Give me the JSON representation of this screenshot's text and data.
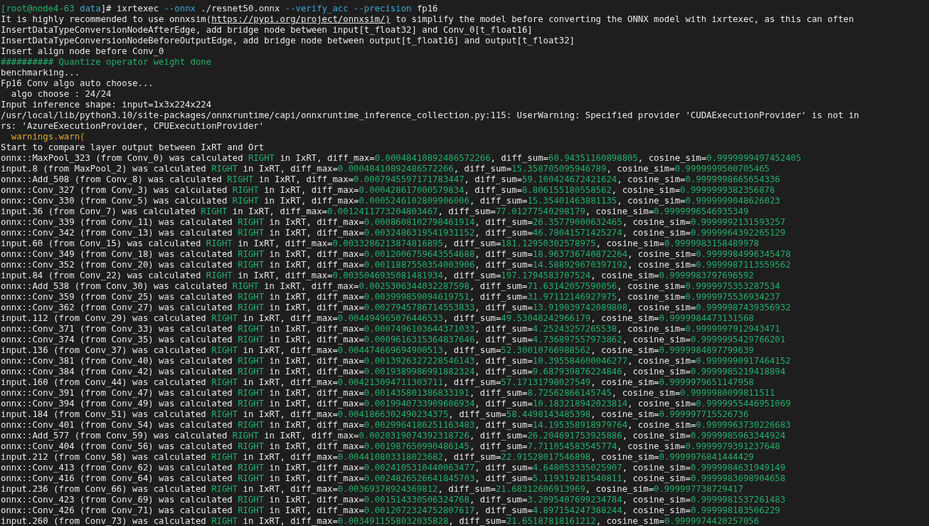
{
  "terminal": {
    "lines": [
      {
        "segments": [
          {
            "text": "[root@node4-63",
            "kind": "host"
          },
          {
            "text": " data",
            "kind": "path"
          },
          {
            "text": "]# ixrtexec ",
            "kind": "plain"
          },
          {
            "text": "--onnx",
            "kind": "flag"
          },
          {
            "text": " ./resnet50.onnx ",
            "kind": "plain"
          },
          {
            "text": "--verify_acc --precision",
            "kind": "flag"
          },
          {
            "text": " fp16",
            "kind": "plain"
          }
        ]
      },
      {
        "segments": [
          {
            "text": "It is highly recommended to use onnxsim(",
            "kind": "plain"
          },
          {
            "text": "https://pypi.org/project/onnxsim/)",
            "kind": "link"
          },
          {
            "text": " to simplify the model before converting the ONNX model with ixrtexec, as this can often",
            "kind": "plain"
          }
        ]
      },
      {
        "segments": [
          {
            "text": "InsertDataTypeConversionNodeAfterEdge, add bridge node between input[t_float32] and Conv_0[t_float16]",
            "kind": "plain"
          }
        ]
      },
      {
        "segments": [
          {
            "text": "InsertDataTypeConversionNodeBeforeOutputEdge, add bridge node between output[t_float16] and output[t_float32]",
            "kind": "plain"
          }
        ]
      },
      {
        "segments": [
          {
            "text": "Insert align node before Conv_0",
            "kind": "plain"
          }
        ]
      },
      {
        "segments": [
          {
            "text": "########## Quantize operator weight done",
            "kind": "ok"
          }
        ]
      },
      {
        "segments": [
          {
            "text": "benchmarking...",
            "kind": "plain"
          }
        ]
      },
      {
        "segments": [
          {
            "text": "Fp16 Conv algo auto choose...",
            "kind": "plain"
          }
        ]
      },
      {
        "segments": [
          {
            "text": "  algo choose : 24/24",
            "kind": "plain"
          }
        ]
      },
      {
        "segments": [
          {
            "text": "Input inference shape: input=1x3x224x224",
            "kind": "plain"
          }
        ]
      },
      {
        "segments": [
          {
            "text": "/usr/local/lib/python3.10/site-packages/onnxruntime/capi/onnxruntime_inference_collection.py:115: UserWarning: Specified provider 'CUDAExecutionProvider' is not in",
            "kind": "plain"
          }
        ]
      },
      {
        "segments": [
          {
            "text": "rs: 'AzureExecutionProvider, CPUExecutionProvider'",
            "kind": "plain"
          }
        ]
      },
      {
        "segments": [
          {
            "text": "  warnings.warn(",
            "kind": "warn"
          }
        ]
      },
      {
        "segments": [
          {
            "text": "Start to compare layer output between IxRT and Ort",
            "kind": "plain"
          }
        ]
      }
    ],
    "results": [
      {
        "subject": "onnx::MaxPool_323 (from Conv_0) was calculated ",
        "verdict": "RIGHT",
        "max_label": " in IxRT, diff_max=",
        "diff_max": "0.00048410892486572266",
        "sum_label": ", diff_sum=",
        "diff_sum": "60.94351160898805",
        "cos_label": ", cosine_sim=",
        "cosine_sim": "0.9999999497452405"
      },
      {
        "subject": "input.8 (from MaxPool_2) was calculated ",
        "verdict": "RIGHT",
        "max_label": " in IxRT, diff_max=",
        "diff_max": "0.00048410892486572266",
        "sum_label": ", diff_sum=",
        "diff_sum": "15.358705095946789",
        "cos_label": ", cosine_sim=",
        "cosine_sim": "0.9999999500705465"
      },
      {
        "subject": "onnx::Add_508 (from Conv_8) was calculated ",
        "verdict": "RIGHT",
        "max_label": " in IxRT, diff_max=",
        "diff_max": "0.0007945597171783447",
        "sum_label": ", diff_sum=",
        "diff_sum": "59.100424672421624",
        "cos_label": ", cosine_sim=",
        "cosine_sim": "0.9999998665654336"
      },
      {
        "subject": "onnx::Conv_327 (from Conv_3) was calculated ",
        "verdict": "RIGHT",
        "max_label": " in IxRT, diff_max=",
        "diff_max": "0.000428617000579834",
        "sum_label": ", diff_sum=",
        "diff_sum": "8.806155180558562",
        "cos_label": ", cosine_sim=",
        "cosine_sim": "0.9999999382356878"
      },
      {
        "subject": "onnx::Conv_330 (from Conv_5) was calculated ",
        "verdict": "RIGHT",
        "max_label": " in IxRT, diff_max=",
        "diff_max": "0.0005246102809906006",
        "sum_label": ", diff_sum=",
        "diff_sum": "15.35401463881135",
        "cos_label": ", cosine_sim=",
        "cosine_sim": "0.9999999048626023"
      },
      {
        "subject": "input.36 (from Conv_7) was calculated ",
        "verdict": "RIGHT",
        "max_label": " in IxRT, diff_max=",
        "diff_max": "0.0012411773204803467",
        "sum_label": ", diff_sum=",
        "diff_sum": "77.01277540298179",
        "cos_label": ", cosine_sim=",
        "cosine_sim": "0.9999996546935349"
      },
      {
        "subject": "onnx::Conv_339 (from Conv_11) was calculated ",
        "verdict": "RIGHT",
        "max_label": " in IxRT, diff_max=",
        "diff_max": "0.0008608102798461914",
        "sum_label": ", diff_sum=",
        "diff_sum": "26.35779000632465",
        "cos_label": ", cosine_sim=",
        "cosine_sim": "0.9999992131593257"
      },
      {
        "subject": "onnx::Conv_342 (from Conv_13) was calculated ",
        "verdict": "RIGHT",
        "max_label": " in IxRT, diff_max=",
        "diff_max": "0.0032486319541931152",
        "sum_label": ", diff_sum=",
        "diff_sum": "46.78041571425274",
        "cos_label": ", cosine_sim=",
        "cosine_sim": "0.9999964392265129"
      },
      {
        "subject": "input.60 (from Conv_15) was calculated ",
        "verdict": "RIGHT",
        "max_label": " in IxRT, diff_max=",
        "diff_max": "0.0033286213874816895",
        "sum_label": ", diff_sum=",
        "diff_sum": "181.12950302578975",
        "cos_label": ", cosine_sim=",
        "cosine_sim": "0.9999983158489978"
      },
      {
        "subject": "onnx::Conv_349 (from Conv_18) was calculated ",
        "verdict": "RIGHT",
        "max_label": " in IxRT, diff_max=",
        "diff_max": "0.0012006759643554688",
        "sum_label": ", diff_sum=",
        "diff_sum": "18.963736740872264",
        "cos_label": ", cosine_sim=",
        "cosine_sim": "0.9999984996345478"
      },
      {
        "subject": "onnx::Conv_352 (from Conv_20) was calculated ",
        "verdict": "RIGHT",
        "max_label": " in IxRT, diff_max=",
        "diff_max": "0.0011887550354003906",
        "sum_label": ", diff_sum=",
        "diff_sum": "14.588929670397192",
        "cos_label": ", cosine_sim=",
        "cosine_sim": "0.9999987113559562"
      },
      {
        "subject": "input.84 (from Conv_22) was calculated ",
        "verdict": "RIGHT",
        "max_label": " in IxRT, diff_max=",
        "diff_max": "0.0035046935081481934",
        "sum_label": ", diff_sum=",
        "diff_sum": "197.1794583707524",
        "cos_label": ", cosine_sim=",
        "cosine_sim": "0.9999983797696592"
      },
      {
        "subject": "onnx::Add_538 (from Conv_30) was calculated ",
        "verdict": "RIGHT",
        "max_label": " in IxRT, diff_max=",
        "diff_max": "0.0025306344032287598",
        "sum_label": ", diff_sum=",
        "diff_sum": "71.63142057590056",
        "cos_label": ", cosine_sim=",
        "cosine_sim": "0.9999975353287534"
      },
      {
        "subject": "onnx::Conv_359 (from Conv_25) was calculated ",
        "verdict": "RIGHT",
        "max_label": " in IxRT, diff_max=",
        "diff_max": "0.003999859094619751",
        "sum_label": ", diff_sum=",
        "diff_sum": "31.97112146927975",
        "cos_label": ", cosine_sim=",
        "cosine_sim": "0.9999975536934237"
      },
      {
        "subject": "onnx::Conv_362 (from Conv_27) was calculated ",
        "verdict": "RIGHT",
        "max_label": " in IxRT, diff_max=",
        "diff_max": "0.0027945786714553833",
        "sum_label": ", diff_sum=",
        "diff_sum": "13.919039742089808",
        "cos_label": ", cosine_sim=",
        "cosine_sim": "0.9999987439356932"
      },
      {
        "subject": "input.112 (from Conv_29) was calculated ",
        "verdict": "RIGHT",
        "max_label": " in IxRT, diff_max=",
        "diff_max": "0.004494965076446533",
        "sum_label": ", diff_sum=",
        "diff_sum": "49.53048242966179",
        "cos_label": ", cosine_sim=",
        "cosine_sim": "0.9999984473131568"
      },
      {
        "subject": "onnx::Conv_371 (from Conv_33) was calculated ",
        "verdict": "RIGHT",
        "max_label": " in IxRT, diff_max=",
        "diff_max": "0.0007496103644371033",
        "sum_label": ", diff_sum=",
        "diff_sum": "4.25243257265538",
        "cos_label": ", cosine_sim=",
        "cosine_sim": "0.9999997912943471"
      },
      {
        "subject": "onnx::Conv_374 (from Conv_35) was calculated ",
        "verdict": "RIGHT",
        "max_label": " in IxRT, diff_max=",
        "diff_max": "0.0009616315364837646",
        "sum_label": ", diff_sum=",
        "diff_sum": "4.736897557973862",
        "cos_label": ", cosine_sim=",
        "cosine_sim": "0.9999995429766201"
      },
      {
        "subject": "input.136 (from Conv_37) was calculated ",
        "verdict": "RIGHT",
        "max_label": " in IxRT, diff_max=",
        "diff_max": "0.004474669694900513",
        "sum_label": ", diff_sum=",
        "diff_sum": "52.30010766988562",
        "cos_label": ", cosine_sim=",
        "cosine_sim": "0.9999984897799639"
      },
      {
        "subject": "onnx::Conv_381 (from Conv_40) was calculated ",
        "verdict": "RIGHT",
        "max_label": " in IxRT, diff_max=",
        "diff_max": "0.0013926327228546143",
        "sum_label": ", diff_sum=",
        "diff_sum": "10.395584600046277",
        "cos_label": ", cosine_sim=",
        "cosine_sim": "0.9999990917464152"
      },
      {
        "subject": "onnx::Conv_384 (from Conv_42) was calculated ",
        "verdict": "RIGHT",
        "max_label": " in IxRT, diff_max=",
        "diff_max": "0.0019389986991882324",
        "sum_label": ", diff_sum=",
        "diff_sum": "9.687939876224846",
        "cos_label": ", cosine_sim=",
        "cosine_sim": "0.9999985219418894"
      },
      {
        "subject": "input.160 (from Conv_44) was calculated ",
        "verdict": "RIGHT",
        "max_label": " in IxRT, diff_max=",
        "diff_max": "0.004213094711303711",
        "sum_label": ", diff_sum=",
        "diff_sum": "57.17131798027549",
        "cos_label": ", cosine_sim=",
        "cosine_sim": "0.9999979651147958"
      },
      {
        "subject": "onnx::Conv_391 (from Conv_47) was calculated ",
        "verdict": "RIGHT",
        "max_label": " in IxRT, diff_max=",
        "diff_max": "0.001435801386833191",
        "sum_label": ", diff_sum=",
        "diff_sum": "8.72562866145745",
        "cos_label": ", cosine_sim=",
        "cosine_sim": "0.9999980099811511"
      },
      {
        "subject": "onnx::Conv_394 (from Conv_49) was calculated ",
        "verdict": "RIGHT",
        "max_label": " in IxRT, diff_max=",
        "diff_max": "0.0019940733909606934",
        "sum_label": ", diff_sum=",
        "diff_sum": "10.183218942023814",
        "cos_label": ", cosine_sim=",
        "cosine_sim": "0.9999955446951069"
      },
      {
        "subject": "input.184 (from Conv_51) was calculated ",
        "verdict": "RIGHT",
        "max_label": " in IxRT, diff_max=",
        "diff_max": "0.0041866302490234375",
        "sum_label": ", diff_sum=",
        "diff_sum": "58.4498143485398",
        "cos_label": ", cosine_sim=",
        "cosine_sim": "0.999997715526736"
      },
      {
        "subject": "onnx::Conv_401 (from Conv_54) was calculated ",
        "verdict": "RIGHT",
        "max_label": " in IxRT, diff_max=",
        "diff_max": "0.0029964186251163483",
        "sum_label": ", diff_sum=",
        "diff_sum": "14.195358918979764",
        "cos_label": ", cosine_sim=",
        "cosine_sim": "0.9999963730226683"
      },
      {
        "subject": "onnx::Add_577 (from Conv_59) was calculated ",
        "verdict": "RIGHT",
        "max_label": " in IxRT, diff_max=",
        "diff_max": "0.0020319074392318726",
        "sum_label": ", diff_sum=",
        "diff_sum": "26.204691753925886",
        "cos_label": ", cosine_sim=",
        "cosine_sim": "0.9999985963344924"
      },
      {
        "subject": "onnx::Conv_404 (from Conv_56) was calculated ",
        "verdict": "RIGHT",
        "max_label": " in IxRT, diff_max=",
        "diff_max": "0.001987650990486145",
        "sum_label": ", diff_sum=",
        "diff_sum": "7.711054583545774",
        "cos_label": ", cosine_sim=",
        "cosine_sim": "0.9999979391237648"
      },
      {
        "subject": "input.212 (from Conv_58) was calculated ",
        "verdict": "RIGHT",
        "max_label": " in IxRT, diff_max=",
        "diff_max": "0.004410803318023682",
        "sum_label": ", diff_sum=",
        "diff_sum": "22.91528017546898",
        "cos_label": ", cosine_sim=",
        "cosine_sim": "0.9999976841444429"
      },
      {
        "subject": "onnx::Conv_413 (from Conv_62) was calculated ",
        "verdict": "RIGHT",
        "max_label": " in IxRT, diff_max=",
        "diff_max": "0.0024105310440063477",
        "sum_label": ", diff_sum=",
        "diff_sum": "4.648053335025907",
        "cos_label": ", cosine_sim=",
        "cosine_sim": "0.9999984631949149"
      },
      {
        "subject": "onnx::Conv_416 (from Conv_64) was calculated ",
        "verdict": "RIGHT",
        "max_label": " in IxRT, diff_max=",
        "diff_max": "0.0024826526641845703",
        "sum_label": ", diff_sum=",
        "diff_sum": "5.119319281540811",
        "cos_label": ", cosine_sim=",
        "cosine_sim": "0.9999983698904658"
      },
      {
        "subject": "input.236 (from Conv_66) was calculated ",
        "verdict": "RIGHT",
        "max_label": " in IxRT, diff_max=",
        "diff_max": "0.00369378924369812",
        "sum_label": ", diff_sum=",
        "diff_sum": "21.68312606913969",
        "cos_label": ", cosine_sim=",
        "cosine_sim": "0.999997738729417"
      },
      {
        "subject": "onnx::Conv_423 (from Conv_69) was calculated ",
        "verdict": "RIGHT",
        "max_label": " in IxRT, diff_max=",
        "diff_max": "0.001514330506324768",
        "sum_label": ", diff_sum=",
        "diff_sum": "3.2095407699234784",
        "cos_label": ", cosine_sim=",
        "cosine_sim": "0.9999981537261483"
      },
      {
        "subject": "onnx::Conv_426 (from Conv_71) was calculated ",
        "verdict": "RIGHT",
        "max_label": " in IxRT, diff_max=",
        "diff_max": "0.0012072324752807617",
        "sum_label": ", diff_sum=",
        "diff_sum": "4.897154247388244",
        "cos_label": ", cosine_sim=",
        "cosine_sim": "0.999998183506229"
      },
      {
        "subject": "input.260 (from Conv_73) was calculated ",
        "verdict": "RIGHT",
        "max_label": " in IxRT, diff_max=",
        "diff_max": "0.0034911558032035828",
        "sum_label": ", diff_sum=",
        "diff_sum": "21.65187818161212",
        "cos_label": ", cosine_sim=",
        "cosine_sim": "0.9999974420257056"
      }
    ]
  }
}
